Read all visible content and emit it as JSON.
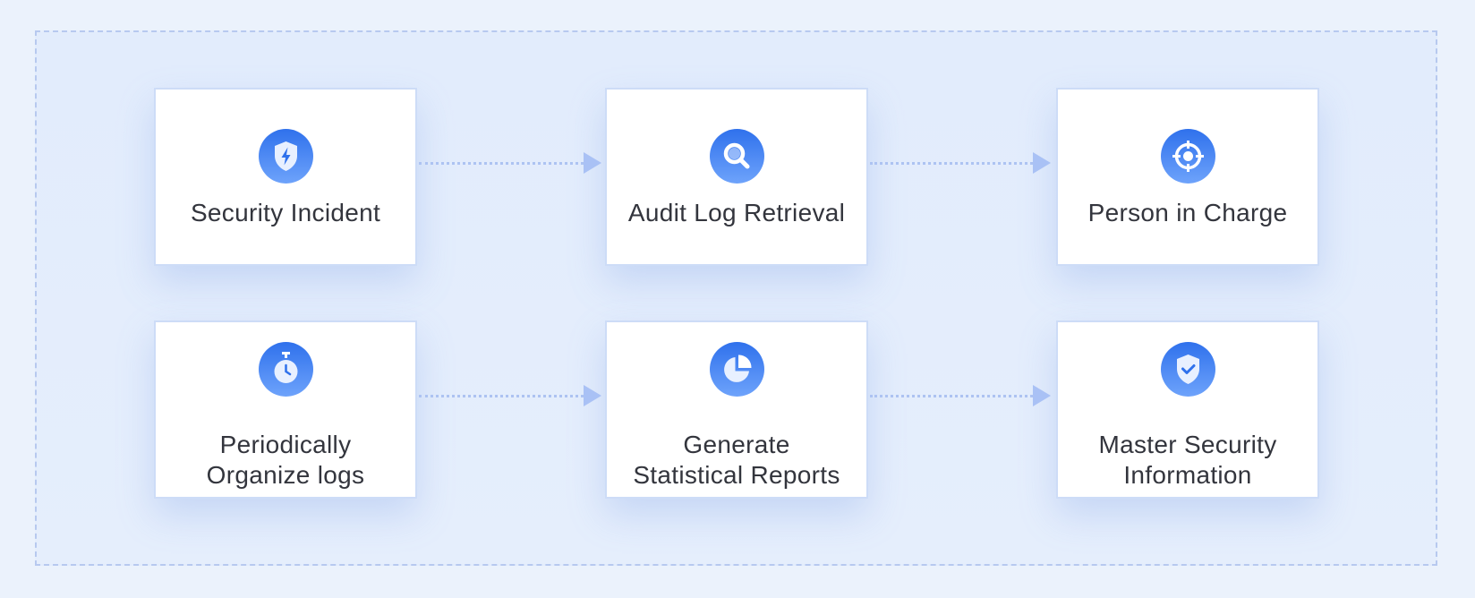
{
  "diagram": {
    "nodes": [
      {
        "id": "security-incident",
        "label": "Security Incident",
        "icon": "shield-bolt-icon"
      },
      {
        "id": "audit-log-retrieval",
        "label": "Audit Log Retrieval",
        "icon": "search-icon"
      },
      {
        "id": "person-in-charge",
        "label": "Person in Charge",
        "icon": "target-icon"
      },
      {
        "id": "periodically-organize-logs",
        "label_line1": "Periodically",
        "label_line2": "Organize logs",
        "icon": "stopwatch-icon"
      },
      {
        "id": "generate-statistical-reports",
        "label_line1": "Generate",
        "label_line2": "Statistical Reports",
        "icon": "pie-chart-icon"
      },
      {
        "id": "master-security-information",
        "label_line1": "Master Security",
        "label_line2": "Information",
        "icon": "shield-check-icon"
      }
    ],
    "edges": [
      {
        "from": "security-incident",
        "to": "audit-log-retrieval"
      },
      {
        "from": "audit-log-retrieval",
        "to": "person-in-charge"
      },
      {
        "from": "periodically-organize-logs",
        "to": "generate-statistical-reports"
      },
      {
        "from": "generate-statistical-reports",
        "to": "master-security-information"
      }
    ]
  },
  "colors": {
    "background": "#ebf2fc",
    "frame_border": "#b7c9ef",
    "card_border": "#cddcf7",
    "icon_gradient_top": "#2f71ec",
    "icon_gradient_bottom": "#6ea3fb",
    "arrow": "#a9c1f5",
    "text": "#33353d"
  }
}
